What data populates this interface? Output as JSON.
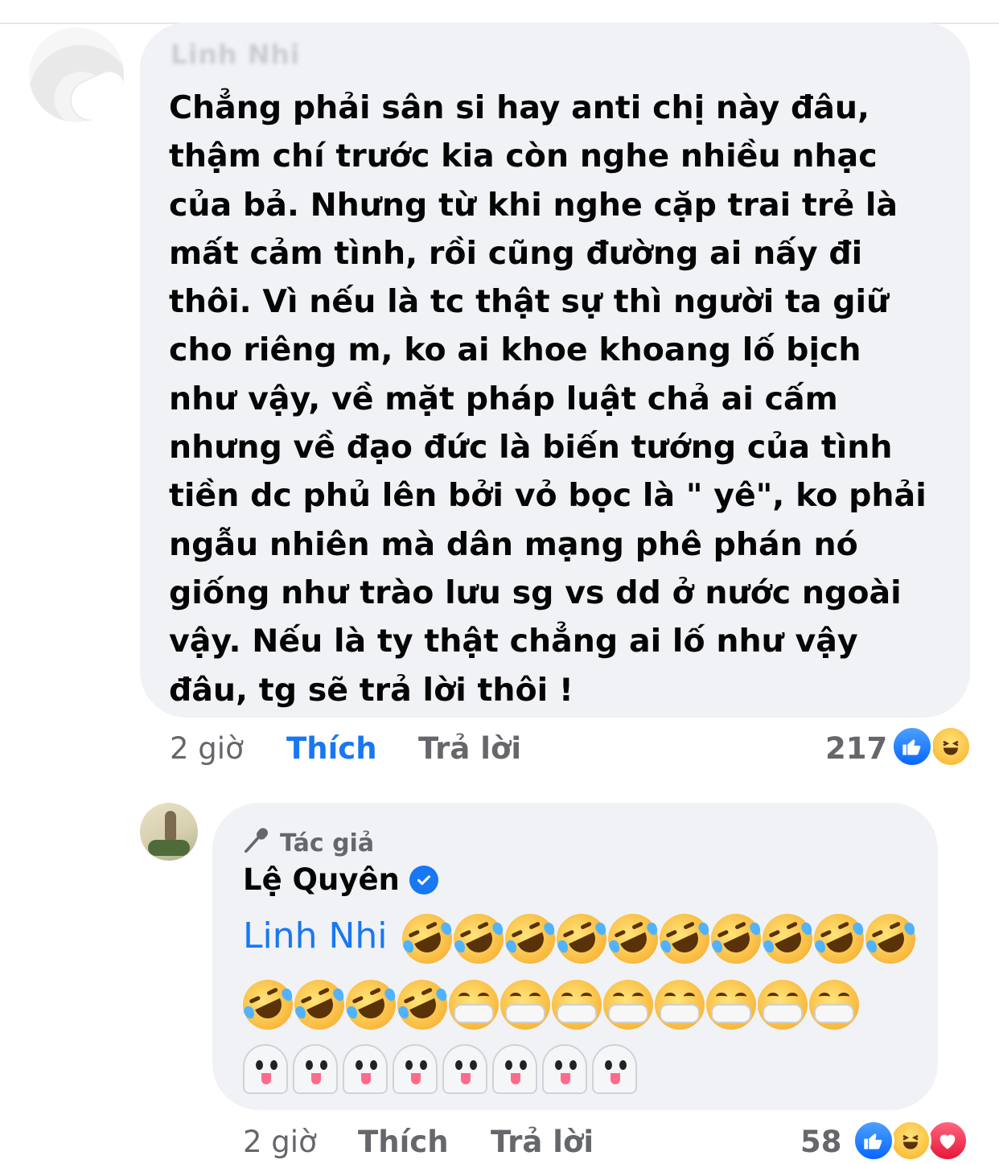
{
  "comment1": {
    "author": "Linh Nhi",
    "text": "Chẳng phải sân si hay anti chị này đâu,\nthậm chí trước kia còn nghe nhiều nhạc\ncủa bả. Nhưng từ khi nghe cặp trai trẻ là\nmất cảm tình, rồi cũng đường ai nấy đi\nthôi. Vì nếu là tc thật sự thì người ta giữ\ncho riêng m, ko ai khoe khoang lố bịch\nnhư vậy, về mặt pháp luật chả ai cấm\nnhưng về đạo đức là biến tướng của tình\ntiền dc phủ lên bởi vỏ bọc là \" yê\", ko phải\nngẫu nhiên mà dân mạng phê phán nó\ngiống như trào lưu sg vs dd ở nước ngoài\nvậy. Nếu là ty thật chẳng ai lố như vậy\nđâu, tg sẽ trả lời thôi !",
    "time": "2 giờ",
    "like_label": "Thích",
    "reply_label": "Trả lời",
    "reaction_count": "217",
    "reactions": [
      "like-icon",
      "haha-icon"
    ]
  },
  "comment2": {
    "author_tag": "Tác giả",
    "author": "Lệ Quyên",
    "mention": "Linh Nhi",
    "emoji_rows": [
      [
        "🤣",
        "🤣",
        "🤣",
        "🤣",
        "🤣",
        "🤣",
        "🤣",
        "🤣",
        "🤣",
        "🤣"
      ],
      [
        "🤣",
        "🤣",
        "🤣",
        "🤣",
        "😷",
        "😷",
        "😷",
        "😷",
        "😷",
        "😷",
        "😷",
        "😷"
      ],
      [
        "👻",
        "👻",
        "👻",
        "👻",
        "👻",
        "👻",
        "👻",
        "👻"
      ]
    ],
    "time": "2 giờ",
    "like_label": "Thích",
    "reply_label": "Trả lời",
    "reaction_count": "58",
    "reactions": [
      "like-icon",
      "haha-icon",
      "love-icon"
    ]
  },
  "colors": {
    "bubble_bg": "#f0f2f5",
    "link_blue": "#1877f2",
    "meta_gray": "#65676b",
    "text": "#050505"
  }
}
